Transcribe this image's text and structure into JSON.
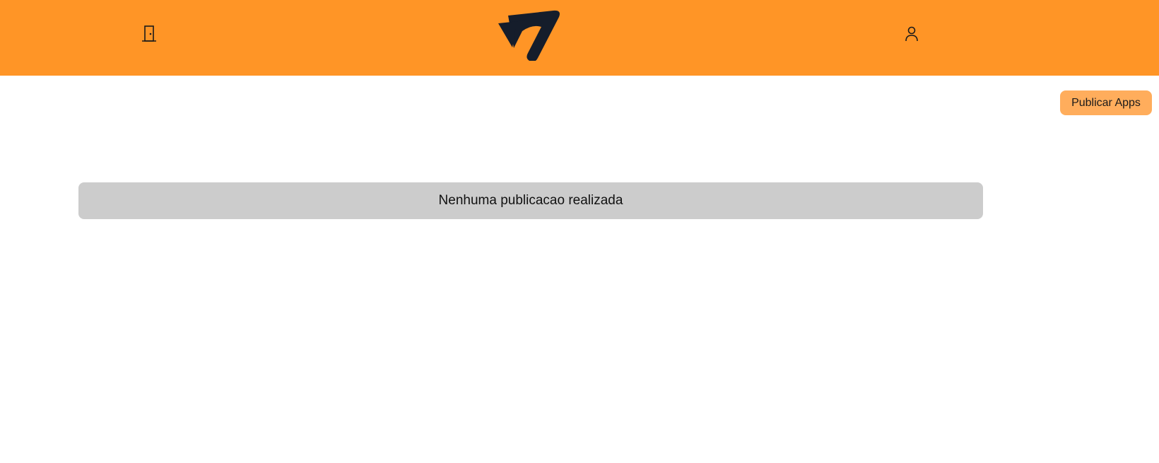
{
  "header": {
    "background": "#ff9526",
    "left_icon": "door-exit-icon",
    "logo": "brand-logo",
    "right_icon": "user-icon"
  },
  "actions": {
    "publish_label": "Publicar Apps",
    "publish_color": "#ffad5c"
  },
  "main": {
    "empty_message": "Nenhuma publicacao realizada",
    "banner_color": "#cccccc"
  }
}
